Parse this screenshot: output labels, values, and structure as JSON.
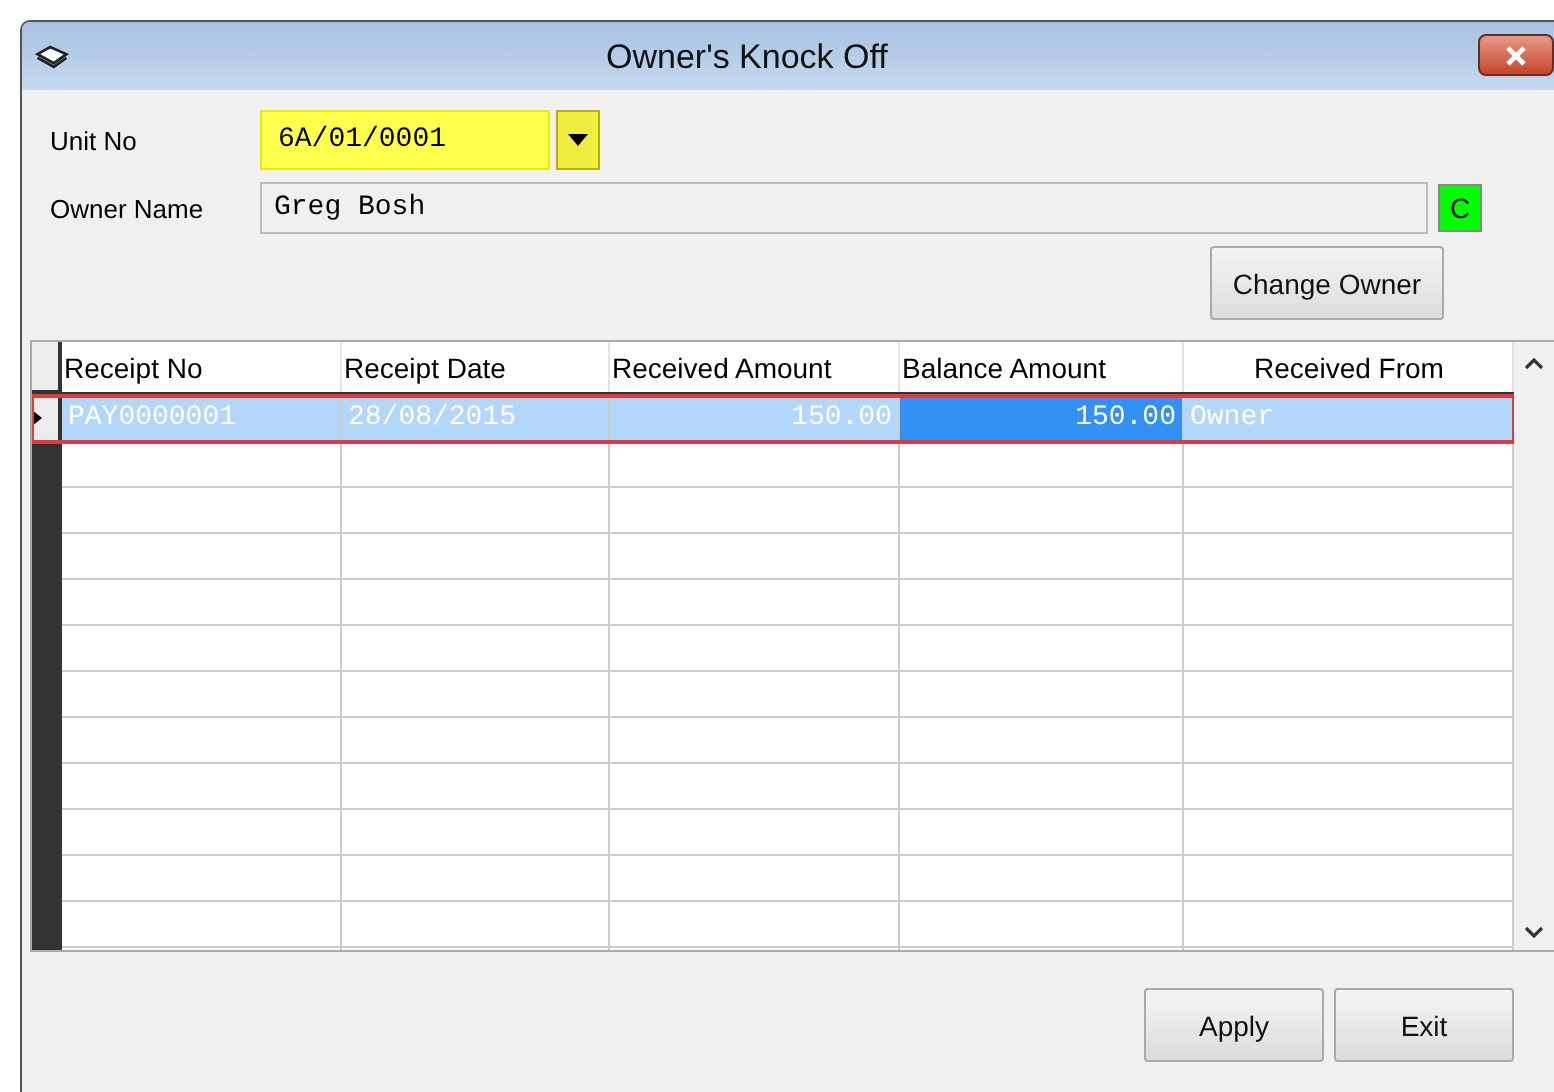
{
  "window": {
    "title": "Owner's Knock Off"
  },
  "unit_no": {
    "label": "Unit No",
    "value": "6A/01/0001",
    "highlighted": true
  },
  "owner_name": {
    "label": "Owner Name",
    "value": "Greg Bosh",
    "status_badge": "C"
  },
  "change_owner_button": "Change Owner",
  "table": {
    "columns": [
      {
        "label": "Receipt No"
      },
      {
        "label": "Receipt Date"
      },
      {
        "label": "Received Amount"
      },
      {
        "label": "Balance Amount"
      },
      {
        "label": "Received From"
      }
    ],
    "rows": [
      {
        "selected": true,
        "outlined": true,
        "cells": [
          {
            "text": "PAY0000001",
            "focused": false
          },
          {
            "text": "28/08/2015",
            "focused": false
          },
          {
            "text": "150.00",
            "focused": false
          },
          {
            "text": "150.00",
            "focused": true
          },
          {
            "text": "Owner",
            "focused": false
          }
        ]
      }
    ]
  },
  "buttons": [
    "Apply",
    "Exit"
  ]
}
